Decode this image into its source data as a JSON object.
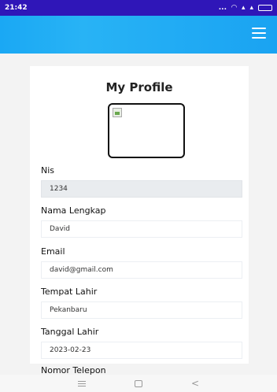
{
  "status_bar": {
    "time": "21:42",
    "dots": "..."
  },
  "app_bar": {
    "menu_icon": "hamburger-menu-icon"
  },
  "profile": {
    "title": "My Profile",
    "fields": [
      {
        "label": "Nis",
        "value": "1234",
        "readonly": true
      },
      {
        "label": "Nama Lengkap",
        "value": "David"
      },
      {
        "label": "Email",
        "value": "david@gmail.com"
      },
      {
        "label": "Tempat Lahir",
        "value": "Pekanbaru"
      },
      {
        "label": "Tanggal Lahir",
        "value": "2023-02-23"
      },
      {
        "label": "Nomor Telepon",
        "value": ""
      }
    ]
  },
  "colors": {
    "status_bar": "#2f16b8",
    "app_bar": "#1aa8f4",
    "readonly_bg": "#e9ecef"
  }
}
